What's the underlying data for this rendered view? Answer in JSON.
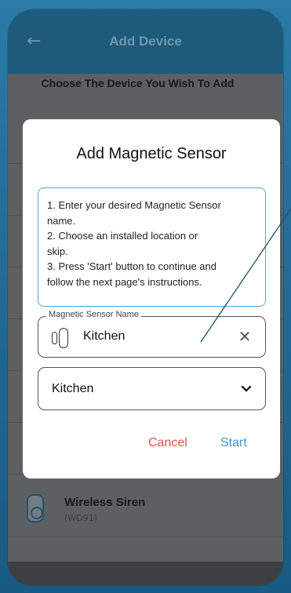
{
  "appbar": {
    "title": "Add Device"
  },
  "list": {
    "heading": "Choose The Device You Wish To Add",
    "items": [
      {
        "name": "Wireless Siren",
        "model": "(WD91)"
      }
    ]
  },
  "dialog": {
    "title": "Add Magnetic Sensor",
    "instructions": [
      "1. Enter your desired Magnetic Sensor",
      "name.",
      "2. Choose an installed location or",
      "skip.",
      "3. Press 'Start' button to continue and",
      "follow the next page's instructions."
    ],
    "name_field": {
      "label": "Magnetic Sensor Name",
      "value": "Kitchen"
    },
    "location_select": {
      "value": "Kitchen"
    },
    "cancel_label": "Cancel",
    "start_label": "Start"
  },
  "colors": {
    "appbar": "#1e5a7b",
    "accent": "#3d98cc",
    "cancel": "#d9534f",
    "instructions_border": "#56a3cf"
  },
  "icons": {
    "back": "arrow-left-icon",
    "sensor": "magnetic-sensor-icon",
    "clear": "close-icon",
    "dropdown": "chevron-down-icon",
    "siren": "siren-icon"
  }
}
